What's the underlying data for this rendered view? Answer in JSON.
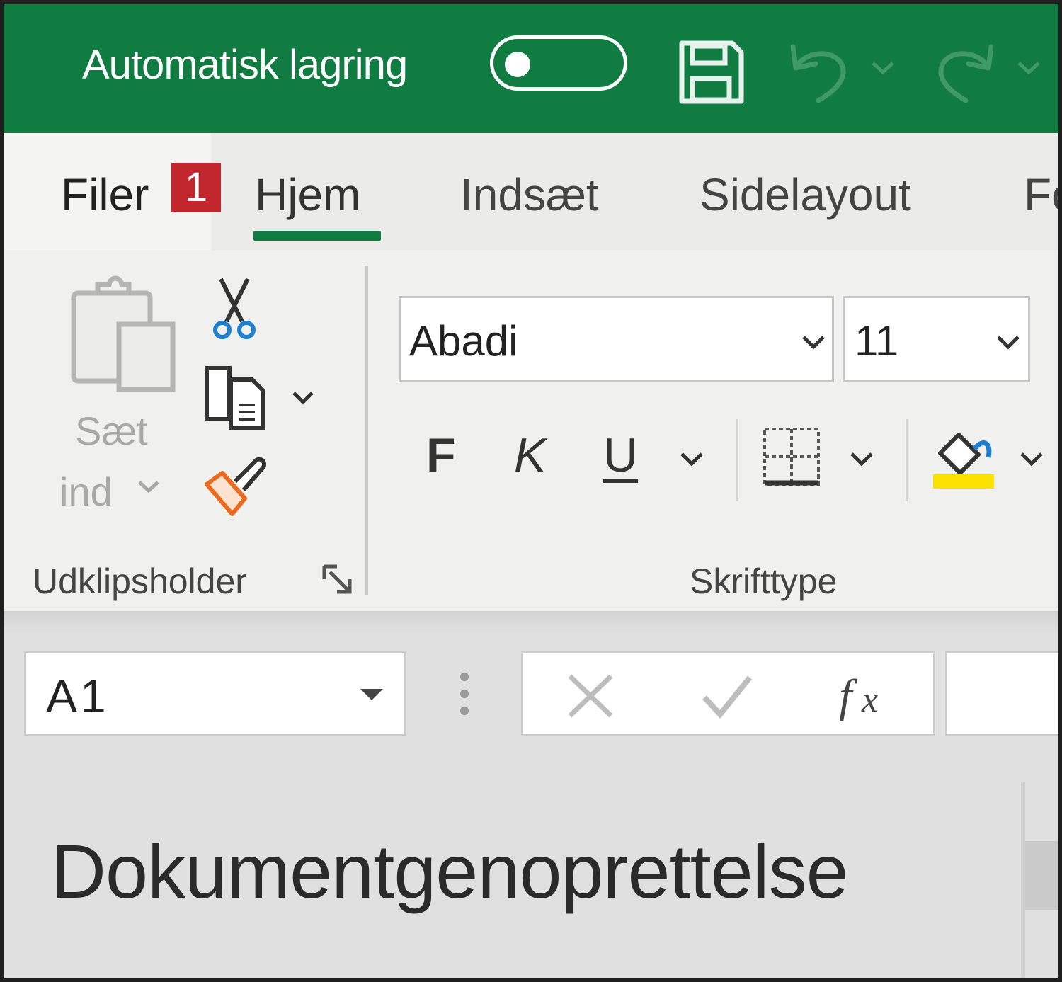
{
  "titlebar": {
    "autosave_label": "Automatisk lagring",
    "autosave_on": false,
    "accent_color": "#107c41"
  },
  "tabs": [
    {
      "label": "Filer",
      "active": false
    },
    {
      "label": "Hjem",
      "active": true
    },
    {
      "label": "Indsæt",
      "active": false
    },
    {
      "label": "Sidelayout",
      "active": false
    },
    {
      "label": "Fo",
      "active": false
    }
  ],
  "badge": {
    "text": "1",
    "color": "#c1272d"
  },
  "clipboard": {
    "paste_label_line1": "Sæt",
    "paste_label_line2": "ind",
    "group_label": "Udklipsholder",
    "icons": [
      "paste-icon",
      "cut-icon",
      "copy-icon",
      "format-painter-icon",
      "dialog-launcher-icon"
    ]
  },
  "font": {
    "font_name": "Abadi",
    "font_size": "11",
    "bold_label": "F",
    "italic_label": "K",
    "underline_label": "U",
    "group_label": "Skrifttype",
    "fill_color": "#fce100",
    "icons": [
      "borders-icon",
      "fill-color-icon"
    ]
  },
  "formula_bar": {
    "name_box": "A1",
    "formula": "",
    "icons": [
      "cancel-icon",
      "enter-icon",
      "fx-icon"
    ]
  },
  "pane": {
    "heading": "Dokumentgenoprettelse"
  }
}
